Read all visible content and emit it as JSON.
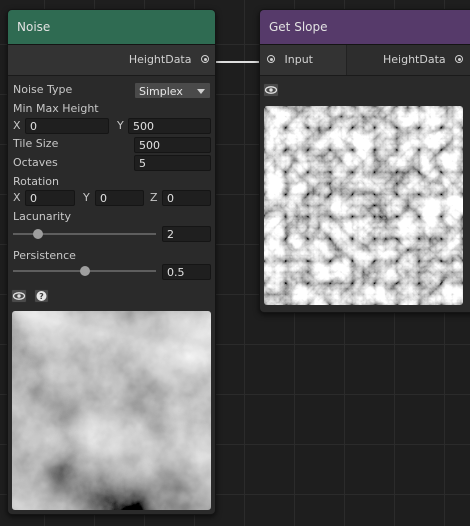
{
  "colors": {
    "noise_header": "#2f6b52",
    "slope_header": "#563a6a",
    "wire": "#dedede"
  },
  "noise_node": {
    "title": "Noise",
    "output_port": "HeightData",
    "noise_type_label": "Noise Type",
    "noise_type_value": "Simplex",
    "min_max_label": "Min Max Height",
    "min_x_axis": "X",
    "min_value": "0",
    "max_y_axis": "Y",
    "max_value": "500",
    "tile_size_label": "Tile Size",
    "tile_size_value": "500",
    "octaves_label": "Octaves",
    "octaves_value": "5",
    "rotation_label": "Rotation",
    "rot_x_axis": "X",
    "rot_x_value": "0",
    "rot_y_axis": "Y",
    "rot_y_value": "0",
    "rot_z_axis": "Z",
    "rot_z_value": "0",
    "lacunarity_label": "Lacunarity",
    "lacunarity_value": "2",
    "lacunarity_slider_fraction": 0.15,
    "persistence_label": "Persistence",
    "persistence_value": "0.5",
    "persistence_slider_fraction": 0.5,
    "icons": [
      "eye-icon",
      "help-icon"
    ]
  },
  "slope_node": {
    "title": "Get Slope",
    "input_port": "Input",
    "output_port": "HeightData",
    "icons": [
      "eye-icon"
    ]
  }
}
